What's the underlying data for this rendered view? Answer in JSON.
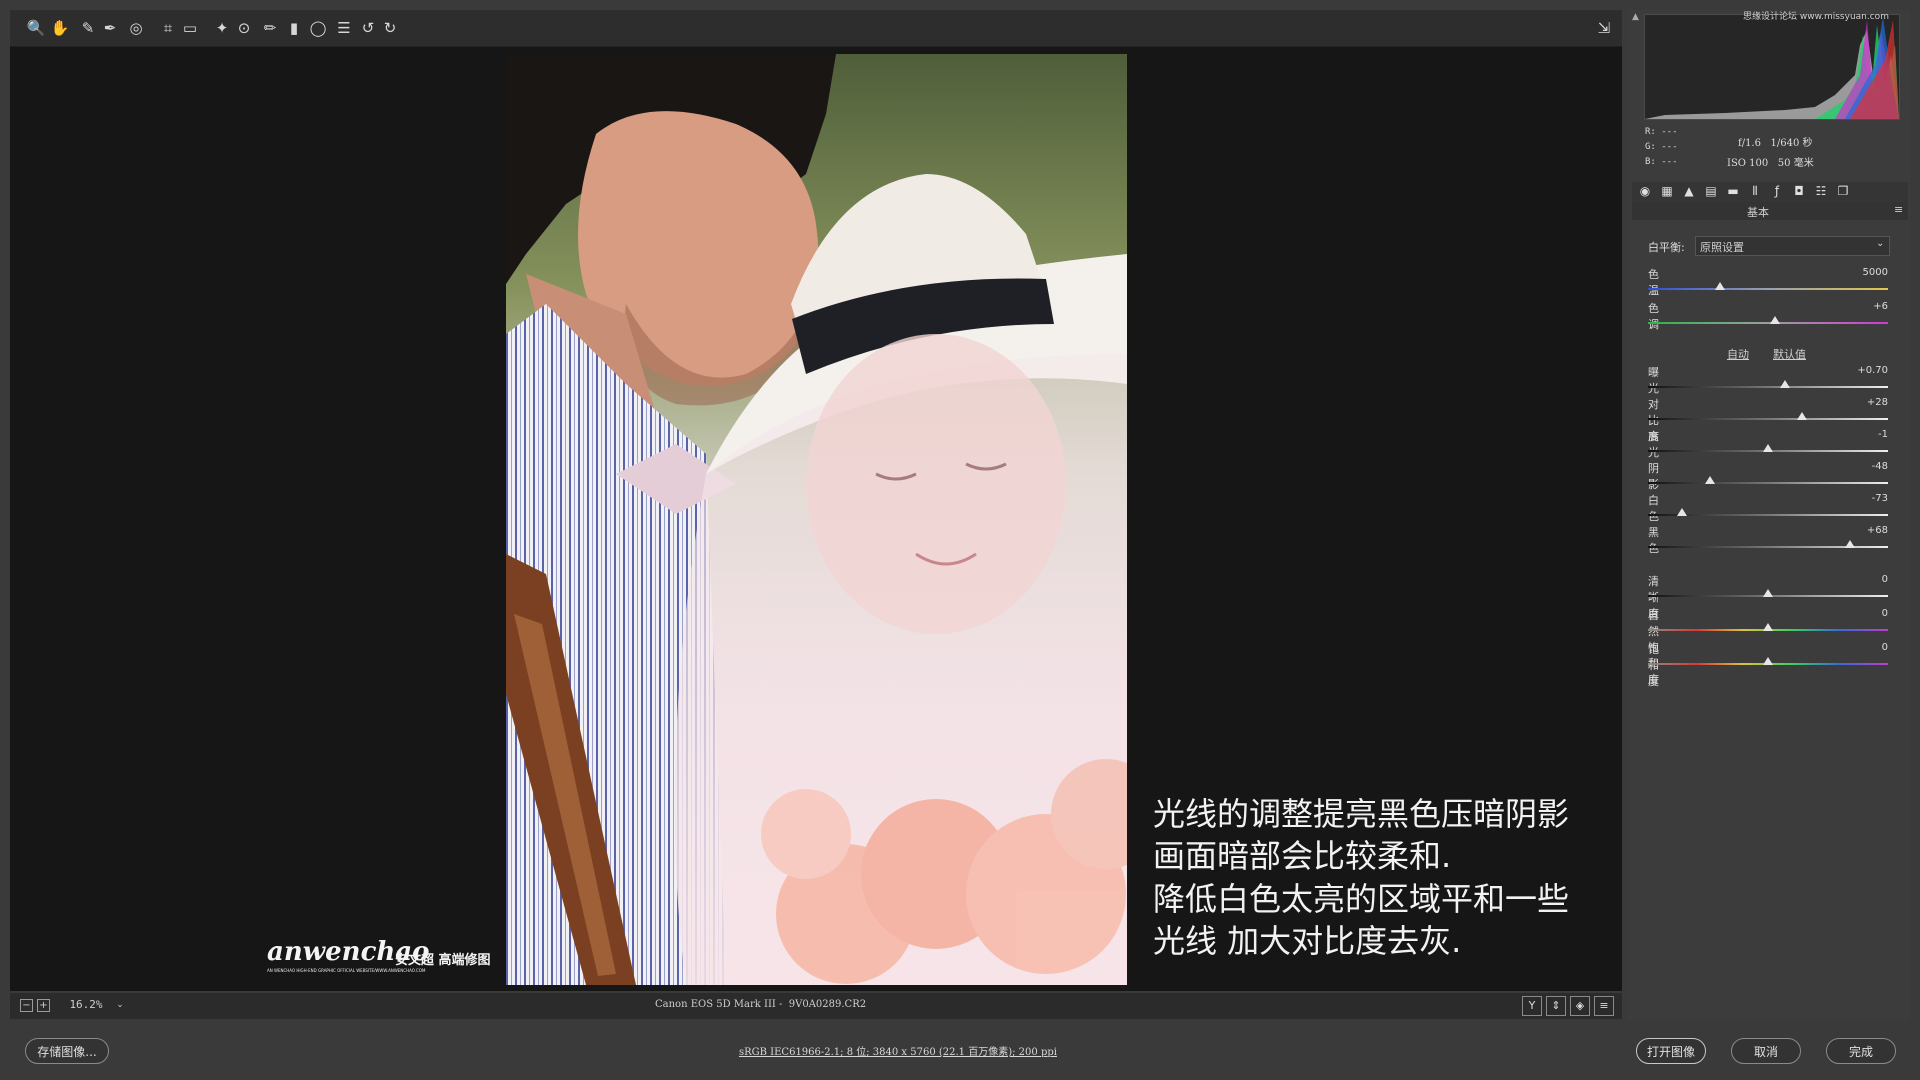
{
  "toolbar": {
    "tools": [
      {
        "name": "zoom-tool-icon",
        "glyph": "🔍"
      },
      {
        "name": "hand-tool-icon",
        "glyph": "✋"
      },
      {
        "name": "white-balance-tool-icon",
        "glyph": "✎"
      },
      {
        "name": "color-sampler-tool-icon",
        "glyph": "✒"
      },
      {
        "name": "targeted-adjustment-tool-icon",
        "glyph": "◎"
      },
      {
        "name": "crop-tool-icon",
        "glyph": "⌗"
      },
      {
        "name": "straighten-tool-icon",
        "glyph": "▭"
      },
      {
        "name": "spot-removal-tool-icon",
        "glyph": "✦"
      },
      {
        "name": "red-eye-tool-icon",
        "glyph": "⊙"
      },
      {
        "name": "adjustment-brush-icon",
        "glyph": "✏"
      },
      {
        "name": "graduated-filter-icon",
        "glyph": "▮"
      },
      {
        "name": "radial-filter-icon",
        "glyph": "◯"
      },
      {
        "name": "preferences-icon",
        "glyph": "☰"
      },
      {
        "name": "rotate-left-icon",
        "glyph": "↺"
      },
      {
        "name": "rotate-right-icon",
        "glyph": "↻"
      }
    ],
    "fullscreen_icon": "⇲"
  },
  "photo": {
    "watermark_script": "anwenchao",
    "watermark_cn": "安文超 高端修图",
    "watermark_small": "AN WENCHAO HIGH-END GRAPHIC OFFICIAL WEBSITE/WWW.ANWENCHAO.COM"
  },
  "caption": {
    "line1": "光线的调整提亮黑色压暗阴影",
    "line2": "画面暗部会比较柔和.",
    "line3": "降低白色太亮的区域平和一些",
    "line4": "光线  加大对比度去灰."
  },
  "preview_bar": {
    "zoom_value": "16.2%",
    "filename": "Canon EOS 5D Mark III -  9V0A0289.CR2",
    "view_buttons": [
      "Y",
      "⇕",
      "◈",
      "≡"
    ]
  },
  "footer": {
    "save_label": "存储图像...",
    "workflow_link": "sRGB IEC61966-2.1; 8 位; 3840 x 5760 (22.1 百万像素); 200 ppi",
    "open_label": "打开图像",
    "cancel_label": "取消",
    "done_label": "完成"
  },
  "info": {
    "r": "R:  ---",
    "g": "G:  ---",
    "b": "B:  ---",
    "aperture_shutter": "f/1.6   1/640 秒",
    "iso_focal": "ISO 100   50 毫米",
    "site_mark": "思缘设计论坛 www.missyuan.com"
  },
  "panel": {
    "title": "基本",
    "wb_label": "白平衡:",
    "wb_value": "原照设置",
    "auto_link": "自动",
    "default_link": "默认值",
    "tab_icons": [
      "basic-tab-icon",
      "tone-curve-tab-icon",
      "detail-tab-icon",
      "hsl-tab-icon",
      "split-toning-tab-icon",
      "lens-tab-icon",
      "effects-tab-icon",
      "camera-calibration-tab-icon",
      "presets-tab-icon",
      "snapshots-tab-icon"
    ],
    "sliders": [
      {
        "name": "temperature",
        "label": "色温",
        "value": "5000",
        "level": 0.3,
        "track": "temp"
      },
      {
        "name": "tint",
        "label": "色调",
        "value": "+6",
        "level": 0.53,
        "track": "tint"
      },
      {
        "name": "exposure",
        "label": "曝光",
        "value": "+0.70",
        "level": 0.57,
        "track": "gray"
      },
      {
        "name": "contrast",
        "label": "对比度",
        "value": "+28",
        "level": 0.64,
        "track": "gray"
      },
      {
        "name": "highlights",
        "label": "高光",
        "value": "-1",
        "level": 0.5,
        "track": "gray"
      },
      {
        "name": "shadows",
        "label": "阴影",
        "value": "-48",
        "level": 0.26,
        "track": "gray"
      },
      {
        "name": "whites",
        "label": "白色",
        "value": "-73",
        "level": 0.14,
        "track": "gray"
      },
      {
        "name": "blacks",
        "label": "黑色",
        "value": "+68",
        "level": 0.84,
        "track": "gray"
      },
      {
        "name": "clarity",
        "label": "清晰度",
        "value": "0",
        "level": 0.5,
        "track": "gray"
      },
      {
        "name": "vibrance",
        "label": "自然饱和度",
        "value": "0",
        "level": 0.5,
        "track": "color"
      },
      {
        "name": "saturation",
        "label": "饱和度",
        "value": "0",
        "level": 0.5,
        "track": "color"
      }
    ]
  }
}
